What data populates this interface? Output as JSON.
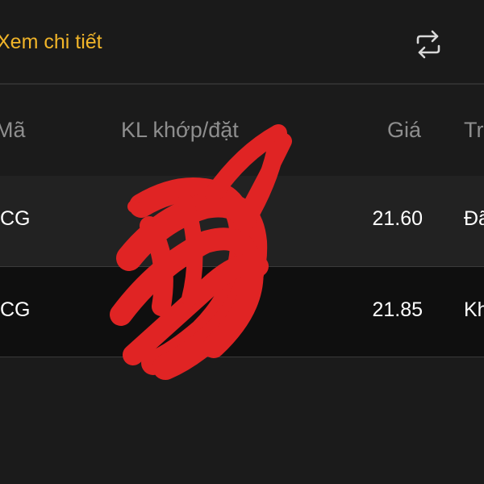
{
  "toolbar": {
    "detail_label": "Xem chi tiết"
  },
  "table": {
    "columns": [
      "Mã",
      "KL khớp/đặt",
      "Giá",
      "Tr"
    ],
    "rows": [
      {
        "code": "CG",
        "price": "21.60",
        "status": "Đã"
      },
      {
        "code": "CG",
        "price": "21.85",
        "status": "Kh"
      }
    ]
  },
  "colors": {
    "accent": "#f0b429",
    "background": "#1b1b1b",
    "row_alt": "#222222",
    "row_dark": "#0f0f0f",
    "header_text": "#8e8e8e",
    "redaction": "#e02424"
  },
  "icons": {
    "swap": "swap-arrows-icon"
  }
}
